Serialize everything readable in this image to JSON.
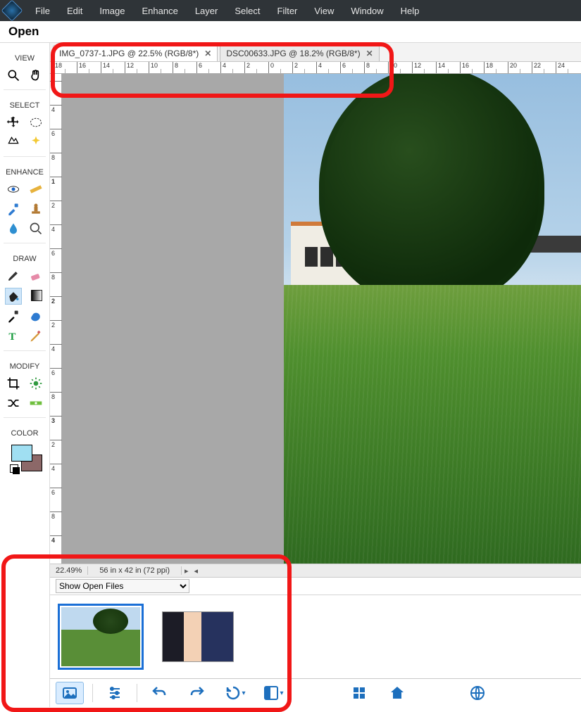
{
  "menu": {
    "file": "File",
    "edit": "Edit",
    "image": "Image",
    "enhance": "Enhance",
    "layer": "Layer",
    "select": "Select",
    "filter": "Filter",
    "view": "View",
    "window": "Window",
    "help": "Help"
  },
  "open_label": "Open",
  "sidebar": {
    "view": "VIEW",
    "select": "SELECT",
    "enhance": "ENHANCE",
    "draw": "DRAW",
    "modify": "MODIFY",
    "color": "COLOR"
  },
  "tabs": [
    {
      "label": "IMG_0737-1.JPG @ 22.5% (RGB/8*)",
      "active": true
    },
    {
      "label": "DSC00633.JPG @ 18.2% (RGB/8*)",
      "active": false
    }
  ],
  "ruler_h": [
    18,
    16,
    14,
    12,
    10,
    8,
    6,
    4,
    2,
    0,
    2,
    4,
    6,
    8,
    10,
    12,
    14,
    16,
    18,
    20,
    22,
    24
  ],
  "ruler_v": [
    2,
    4,
    6,
    8,
    0,
    2,
    4,
    6,
    8,
    0,
    2,
    4,
    6,
    8,
    0,
    2,
    4,
    6,
    8,
    0,
    2,
    4,
    6,
    8
  ],
  "ruler_v_big": [
    1,
    2,
    3,
    4
  ],
  "status": {
    "zoom": "22.49%",
    "dims": "56 in x 42 in (72 ppi)"
  },
  "bin": {
    "selector": "Show Open Files"
  }
}
